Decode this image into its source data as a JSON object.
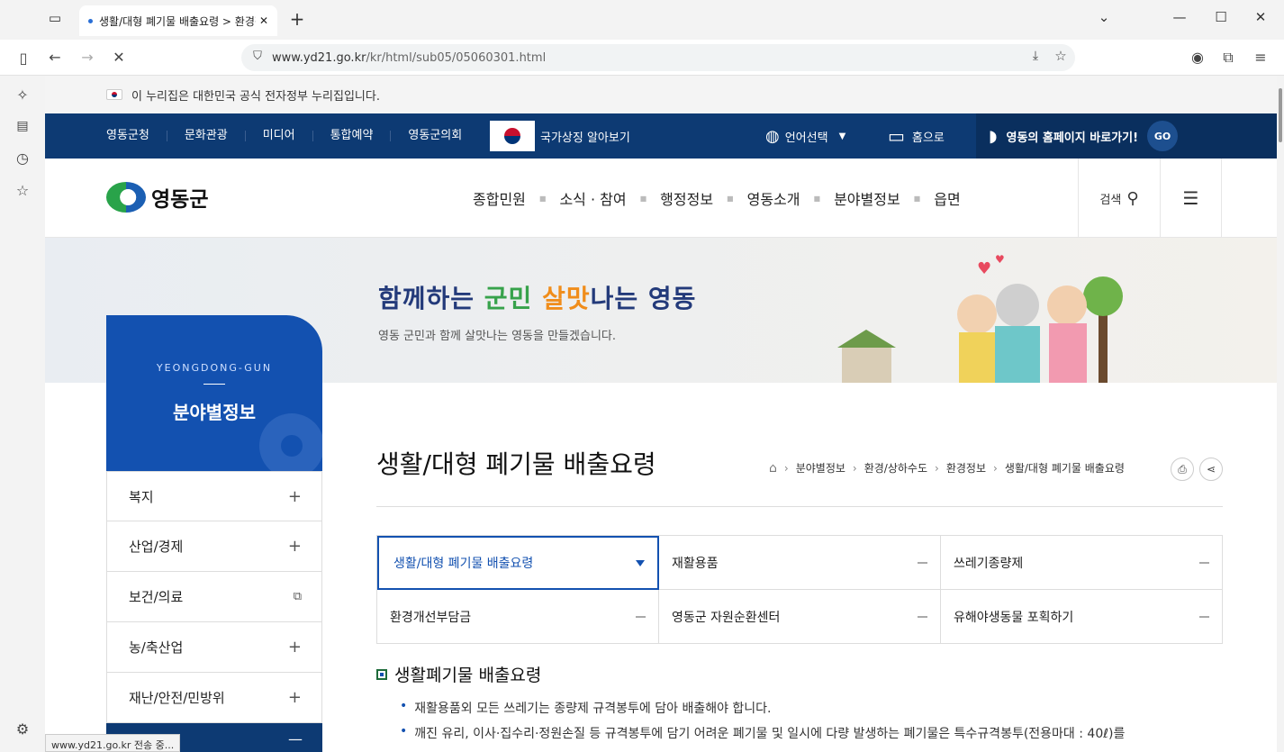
{
  "browser": {
    "tab_title": "생활/대형 폐기물 배출요령 > 환경정보",
    "url_host": "www.yd21.go.kr",
    "url_path": "/kr/html/sub05/05060301.html",
    "status_text": "www.yd21.go.kr 전송 중..."
  },
  "gov_notice": "이 누리집은 대한민국 공식 전자정부 누리집입니다.",
  "topnav": {
    "links": [
      "영동군청",
      "문화관광",
      "미디어",
      "통합예약",
      "영동군의회"
    ],
    "symbol_label": "국가상징 알아보기",
    "language": "언어선택",
    "home": "홈으로",
    "goto_homepage": "영동의 홈페이지 바로가기!",
    "go": "GO"
  },
  "header": {
    "logo": "영동군",
    "menu": [
      "종합민원",
      "소식 · 참여",
      "행정정보",
      "영동소개",
      "분야별정보",
      "읍면"
    ],
    "search": "검색"
  },
  "banner": {
    "slogan_parts": [
      "함께하는 ",
      "군민 ",
      "살맛",
      "나는 영동"
    ],
    "subtitle": "영동 군민과 함께 살맛나는 영동을 만들겠습니다."
  },
  "sidemenu": {
    "en_title": "YEONGDONG-GUN",
    "title": "분야별정보",
    "items": [
      {
        "label": "복지",
        "icon": "plus-icon"
      },
      {
        "label": "산업/경제",
        "icon": "plus-icon"
      },
      {
        "label": "보건/의료",
        "icon": "external-link-icon"
      },
      {
        "label": "농/축산업",
        "icon": "plus-icon"
      },
      {
        "label": "재난/안전/민방위",
        "icon": "plus-icon"
      }
    ]
  },
  "content": {
    "title": "생활/대형 폐기물 배출요령",
    "breadcrumb": [
      "분야별정보",
      "환경/상하수도",
      "환경정보",
      "생활/대형 폐기물 배출요령"
    ],
    "tabs": [
      "생활/대형 폐기물 배출요령",
      "재활용품",
      "쓰레기종량제",
      "환경개선부담금",
      "영동군 자원순환센터",
      "유해야생동물 포획하기"
    ],
    "section_title": "생활폐기물 배출요령",
    "bullets": [
      "재활용품외 모든 쓰레기는 종량제 규격봉투에 담아 배출해야 합니다.",
      "깨진 유리, 이사·집수리·정원손질 등 규격봉투에 담기 어려운 폐기물 및 일시에 다량 발생하는 폐기물은 특수규격봉투(전용마대 : 40ℓ)를"
    ]
  },
  "colors": {
    "navy": "#0d3a73",
    "blue": "#1351b0"
  }
}
